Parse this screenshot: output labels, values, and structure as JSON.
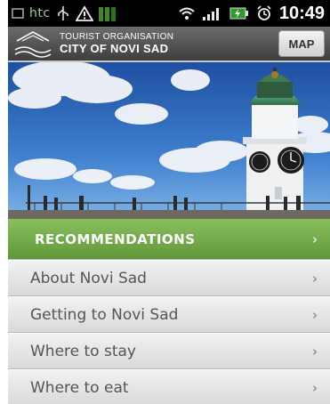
{
  "status_bar": {
    "carrier": "htc",
    "time": "10:49",
    "icons": [
      "sim-icon",
      "usb-icon",
      "warning-icon",
      "signal-bars-icon",
      "wifi-icon",
      "cell-signal-icon",
      "battery-charging-icon",
      "alarm-icon"
    ]
  },
  "header": {
    "org_line1": "TOURIST ORGANISATION",
    "org_line2": "CITY OF NOVI SAD",
    "map_button": "MAP",
    "logo_icon": "novi-sad-logo-icon"
  },
  "hero": {
    "image": "petrovaradin-clock-tower-photo"
  },
  "menu": {
    "items": [
      {
        "label": "RECOMMENDATIONS",
        "active": true
      },
      {
        "label": "About Novi Sad",
        "active": false
      },
      {
        "label": "Getting to Novi Sad",
        "active": false
      },
      {
        "label": "Where to stay",
        "active": false
      },
      {
        "label": "Where to eat",
        "active": false
      }
    ],
    "chevron": "›"
  },
  "colors": {
    "active_green": "#6fa744",
    "header_gray": "#555555",
    "status_black": "#000000"
  }
}
